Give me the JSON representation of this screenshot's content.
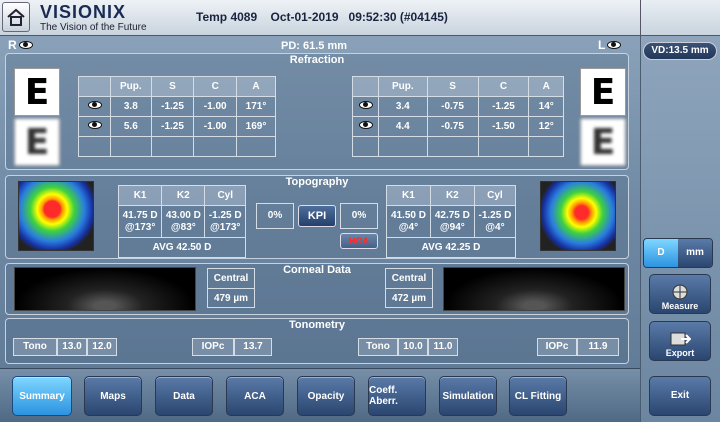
{
  "header": {
    "brand": "VISIONIX",
    "tagline": "The Vision of the Future",
    "exam_info": "Temp 4089    Oct-01-2019   09:52:30 (#04145)"
  },
  "vd": "VD:13.5 mm",
  "pd": "PD:  61.5 mm",
  "right_eye_label": "R",
  "left_eye_label": "L",
  "refraction": {
    "title": "Refraction",
    "headers": [
      "Pup.",
      "S",
      "C",
      "A"
    ],
    "right": [
      {
        "pup": "3.8",
        "s": "-1.25",
        "c": "-1.00",
        "a": "171°"
      },
      {
        "pup": "5.6",
        "s": "-1.25",
        "c": "-1.00",
        "a": "169°"
      }
    ],
    "left": [
      {
        "pup": "3.4",
        "s": "-0.75",
        "c": "-1.25",
        "a": "14°"
      },
      {
        "pup": "4.4",
        "s": "-0.75",
        "c": "-1.50",
        "a": "12°"
      }
    ],
    "chart_letter": "E"
  },
  "topography": {
    "title": "Topography",
    "headers": [
      "K1",
      "K2",
      "Cyl"
    ],
    "right": {
      "k1": "41.75 D",
      "k1_axis": "@173°",
      "k2": "43.00 D",
      "k2_axis": "@83°",
      "cyl": "-1.25 D",
      "cyl_axis": "@173°",
      "avg": "AVG 42.50 D"
    },
    "left": {
      "k1": "41.50 D",
      "k1_axis": "@4°",
      "k2": "42.75 D",
      "k2_axis": "@94°",
      "cyl": "-1.25 D",
      "cyl_axis": "@4°",
      "avg": "AVG 42.25 D"
    },
    "kpi_right": "0%",
    "kpi_label": "KPI",
    "kpi_left": "0%",
    "hoa_label": "HOA"
  },
  "corneal": {
    "title": "Corneal Data",
    "right": {
      "label": "Central",
      "value": "479 µm"
    },
    "left": {
      "label": "Central",
      "value": "472 µm"
    }
  },
  "tonometry": {
    "title": "Tonometry",
    "right": {
      "tono_label": "Tono",
      "tono1": "13.0",
      "tono2": "12.0",
      "iopc_label": "IOPc",
      "iopc": "13.7"
    },
    "left": {
      "tono_label": "Tono",
      "tono1": "10.0",
      "tono2": "11.0",
      "iopc_label": "IOPc",
      "iopc": "11.9"
    }
  },
  "tabs": [
    "Summary",
    "Maps",
    "Data",
    "ACA",
    "Opacity",
    "Coeff. Aberr.",
    "Simulation",
    "CL Fitting"
  ],
  "unit_toggle": {
    "d": "D",
    "mm": "mm"
  },
  "side_buttons": {
    "measure": "Measure",
    "export": "Export",
    "exit": "Exit"
  }
}
